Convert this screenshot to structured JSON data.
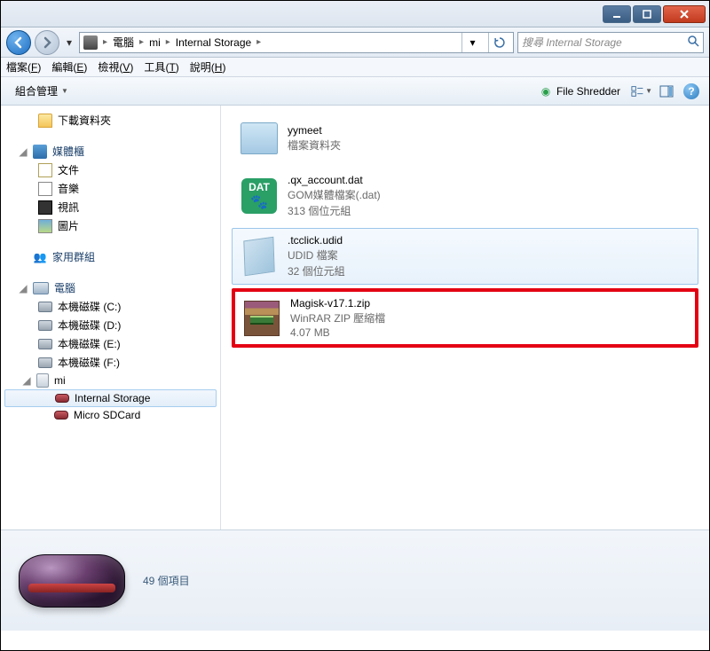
{
  "window": {
    "title": ""
  },
  "address": {
    "parts": [
      "電腦",
      "mi",
      "Internal Storage"
    ]
  },
  "search": {
    "placeholder": "搜尋 Internal Storage"
  },
  "menubar": [
    {
      "label": "檔案",
      "key": "F"
    },
    {
      "label": "編輯",
      "key": "E"
    },
    {
      "label": "檢視",
      "key": "V"
    },
    {
      "label": "工具",
      "key": "T"
    },
    {
      "label": "說明",
      "key": "H"
    }
  ],
  "toolbar": {
    "organize": "組合管理",
    "shredder": "File Shredder"
  },
  "sidebar": {
    "downloads": "下載資料夾",
    "libraries": "媒體櫃",
    "docs": "文件",
    "music": "音樂",
    "video": "視訊",
    "pics": "圖片",
    "homegroup": "家用群組",
    "computer": "電腦",
    "drive_c": "本機磁碟 (C:)",
    "drive_d": "本機磁碟 (D:)",
    "drive_e": "本機磁碟 (E:)",
    "drive_f": "本機磁碟 (F:)",
    "mi": "mi",
    "internal": "Internal Storage",
    "sdcard": "Micro SDCard"
  },
  "files": [
    {
      "name": "yymeet",
      "meta1": "檔案資料夾",
      "meta2": ""
    },
    {
      "name": ".qx_account.dat",
      "meta1": "GOM媒體檔案(.dat)",
      "meta2": "313 個位元組"
    },
    {
      "name": ".tcclick.udid",
      "meta1": "UDID 檔案",
      "meta2": "32 個位元組"
    },
    {
      "name": "Magisk-v17.1.zip",
      "meta1": "WinRAR ZIP 壓縮檔",
      "meta2": "4.07 MB"
    }
  ],
  "status": {
    "count": "49 個項目"
  }
}
